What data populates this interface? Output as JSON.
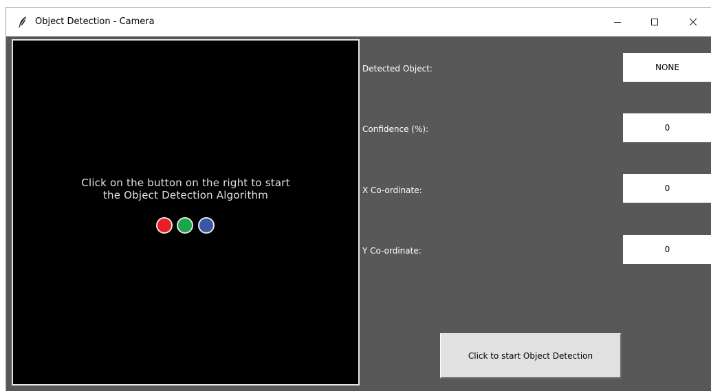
{
  "window": {
    "title": "Object Detection - Camera",
    "icon": "feather-icon",
    "controls": [
      "minimize-icon",
      "maximize-icon",
      "close-icon"
    ]
  },
  "canvas": {
    "message_line1": "Click on the button on the right to start",
    "message_line2": "the Object Detection Algorithm",
    "dots": [
      {
        "name": "red-dot",
        "color": "#ec1c24"
      },
      {
        "name": "green-dot",
        "color": "#1aa64b"
      },
      {
        "name": "blue-dot",
        "color": "#3b56a8"
      }
    ]
  },
  "fields": {
    "detected_object": {
      "label": "Detected Object:",
      "value": "NONE"
    },
    "confidence": {
      "label": "Confidence (%):",
      "value": "0"
    },
    "x_coordinate": {
      "label": "X Co-ordinate:",
      "value": "0"
    },
    "y_coordinate": {
      "label": "Y Co-ordinate:",
      "value": "0"
    }
  },
  "start_button": {
    "label": "Click to start Object Detection"
  },
  "colors": {
    "panel_background": "#585858",
    "canvas_background": "#000000",
    "button_background": "#e1e1e1"
  }
}
